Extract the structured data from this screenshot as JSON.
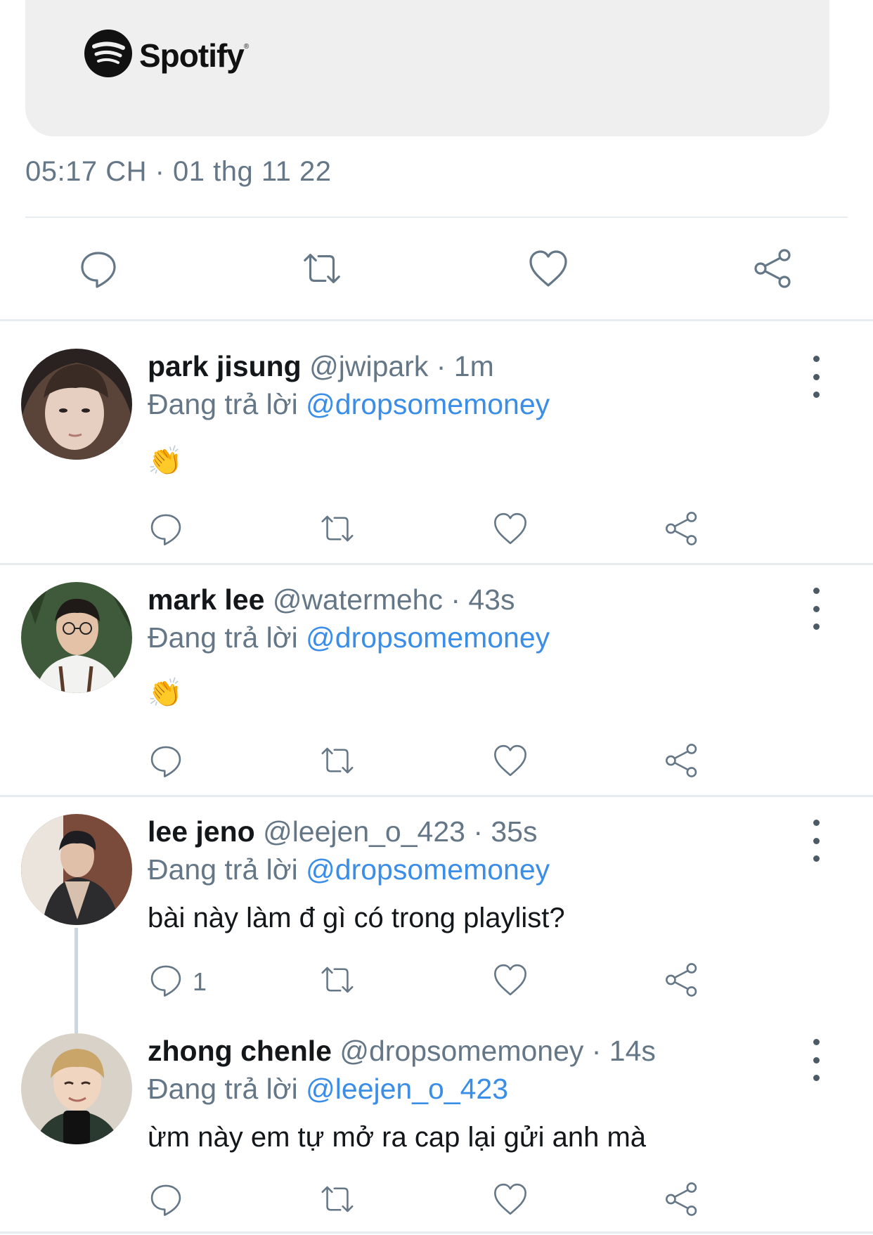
{
  "card": {
    "brand": "Spotify"
  },
  "main_tweet": {
    "timestamp": "05:17 CH · 01 thg 11 22"
  },
  "reply_prefix": "Đang trả lời",
  "replies": [
    {
      "name": "park jisung",
      "meta": "@jwipark · 1m",
      "mention": "@dropsomemoney",
      "text": "👏"
    },
    {
      "name": "mark lee",
      "meta": "@watermehc · 43s",
      "mention": "@dropsomemoney",
      "text": "👏"
    },
    {
      "name": "lee jeno",
      "meta": "@leejen_o_423 · 35s",
      "mention": "@dropsomemoney",
      "text": "bài này làm đ gì có trong playlist?",
      "reply_count": "1"
    },
    {
      "name": "zhong chenle",
      "meta": "@dropsomemoney · 14s",
      "mention": "@leejen_o_423",
      "text": "ừm này em tự mở ra cap lại gửi anh mà"
    }
  ],
  "colors": {
    "link": "#3a8ee8",
    "muted": "#657786",
    "spotify": "#111111",
    "card_bg": "#efeff0"
  }
}
